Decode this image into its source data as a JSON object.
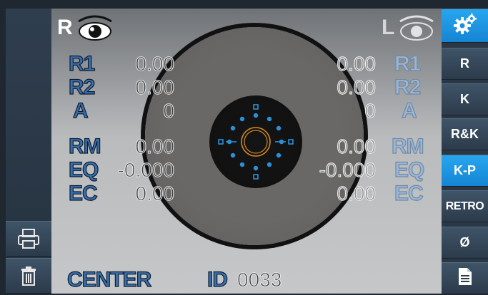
{
  "left_eye": {
    "letter": "R"
  },
  "right_eye": {
    "letter": "L"
  },
  "left_values": {
    "R1": {
      "label": "R1",
      "value": "0.00"
    },
    "R2": {
      "label": "R2",
      "value": "0.00"
    },
    "A": {
      "label": "A",
      "value": "0"
    },
    "RM": {
      "label": "RM",
      "value": "0.00"
    },
    "EQ": {
      "label": "EQ",
      "value": "-0.000"
    },
    "EC": {
      "label": "EC",
      "value": "0.00"
    }
  },
  "right_values": {
    "R1": {
      "label": "R1",
      "value": "0.00"
    },
    "R2": {
      "label": "R2",
      "value": "0.00"
    },
    "A": {
      "label": "A",
      "value": "0"
    },
    "RM": {
      "label": "RM",
      "value": "0.00"
    },
    "EQ": {
      "label": "EQ",
      "value": "-0.000"
    },
    "EC": {
      "label": "EC",
      "value": "0.00"
    }
  },
  "bottom": {
    "mode": "CENTER",
    "id_label": "ID",
    "id_value": "0033"
  },
  "menu": {
    "settings_icon": "gears-icon",
    "buttons": [
      {
        "label": "R",
        "active": false
      },
      {
        "label": "K",
        "active": false
      },
      {
        "label": "R&K",
        "active": false
      },
      {
        "label": "K-P",
        "active": true
      },
      {
        "label": "RETRO",
        "active": false
      },
      {
        "label": "Ø",
        "active": false
      }
    ],
    "document_icon": "document-icon"
  },
  "left_tools": {
    "print_icon": "printer-icon",
    "delete_icon": "trash-icon"
  },
  "colors": {
    "accent_blue": "#1e8fe0",
    "label_blue": "#3a6fa8",
    "ring_orange": "#d38a24",
    "dot_blue": "#2d8fd6"
  }
}
